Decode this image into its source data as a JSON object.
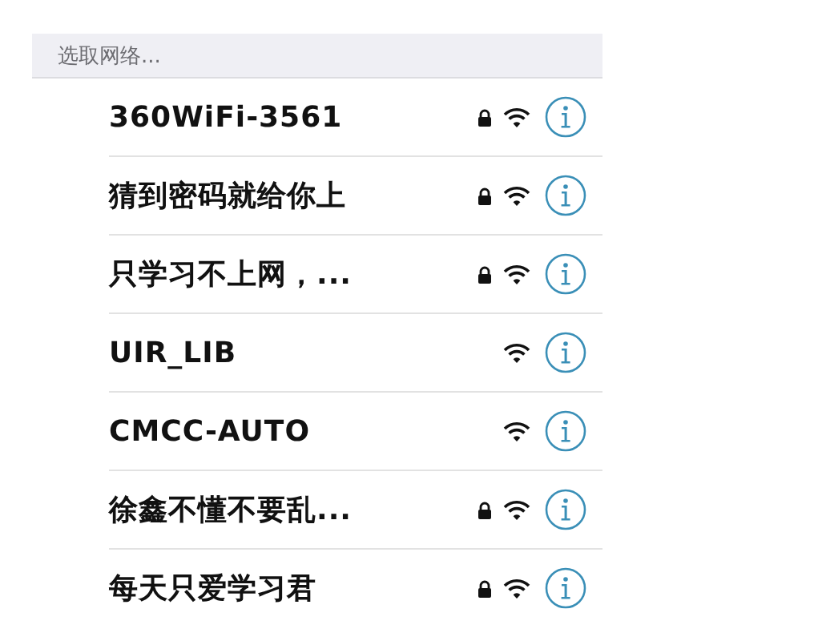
{
  "section_header": "选取网络...",
  "networks": [
    {
      "name": "360WiFi-3561",
      "locked": true
    },
    {
      "name": "猜到密码就给你上",
      "locked": true
    },
    {
      "name": "只学习不上网，...",
      "locked": true
    },
    {
      "name": "UIR_LIB",
      "locked": false
    },
    {
      "name": "CMCC-AUTO",
      "locked": false
    },
    {
      "name": "徐鑫不懂不要乱...",
      "locked": true
    },
    {
      "name": "每天只爱学习君",
      "locked": true
    }
  ]
}
